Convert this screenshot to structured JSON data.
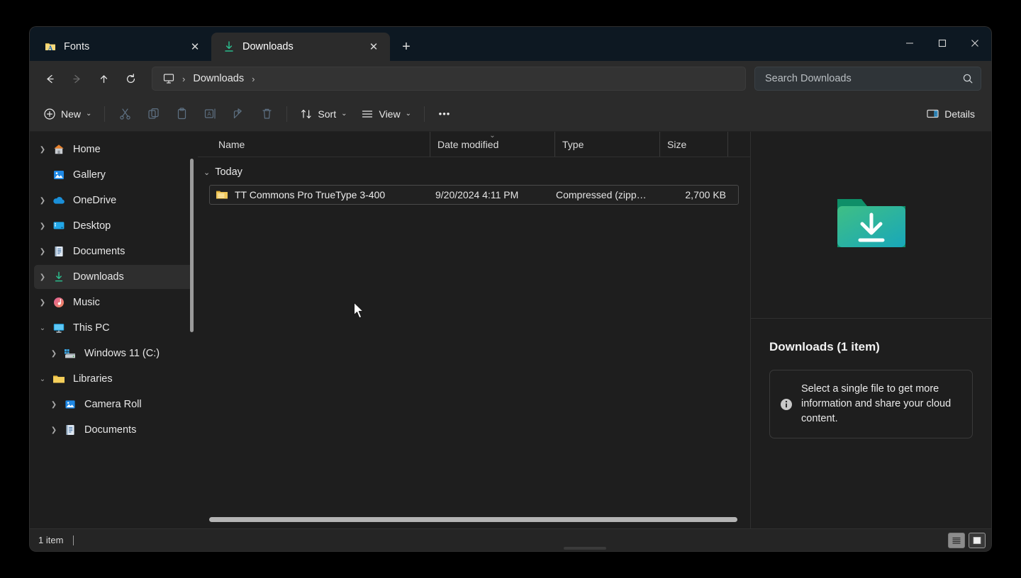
{
  "window": {
    "controls": {
      "minimize": "minimize-button",
      "maximize": "maximize-button",
      "close": "close-button"
    }
  },
  "tabs": [
    {
      "title": "Fonts",
      "icon": "fonts-folder-icon",
      "active": false,
      "close_label": "✕"
    },
    {
      "title": "Downloads",
      "icon": "downloads-arrow-icon",
      "active": true,
      "close_label": "✕"
    }
  ],
  "new_tab_label": "+",
  "navigation": {
    "back": "←",
    "forward": "→",
    "up": "↑",
    "refresh": "↻"
  },
  "breadcrumb": {
    "root_icon": "this-pc-icon",
    "items": [
      "Downloads"
    ],
    "separator": "›"
  },
  "search": {
    "placeholder": "Search Downloads",
    "icon": "search-icon"
  },
  "toolbar": {
    "new_label": "New",
    "new_icon": "plus-circle-icon",
    "cut_icon": "scissors-icon",
    "copy_icon": "copy-icon",
    "paste_icon": "paste-icon",
    "rename_icon": "rename-icon",
    "share_icon": "share-icon",
    "delete_icon": "trash-icon",
    "sort_label": "Sort",
    "sort_icon": "sort-arrows-icon",
    "view_label": "View",
    "view_icon": "view-lines-icon",
    "more_label": "•••",
    "details_label": "Details",
    "details_icon": "details-pane-icon",
    "chevron": "⌄"
  },
  "sidebar": {
    "items": [
      {
        "label": "Home",
        "icon": "home-icon",
        "expandable": true,
        "expanded": false,
        "indent": 0,
        "selected": false
      },
      {
        "label": "Gallery",
        "icon": "gallery-icon",
        "expandable": false,
        "expanded": false,
        "indent": 0,
        "selected": false
      },
      {
        "label": "OneDrive",
        "icon": "onedrive-icon",
        "expandable": true,
        "expanded": false,
        "indent": 0,
        "selected": false
      },
      {
        "label": "Desktop",
        "icon": "desktop-icon",
        "expandable": true,
        "expanded": false,
        "indent": 0,
        "selected": false
      },
      {
        "label": "Documents",
        "icon": "documents-icon",
        "expandable": true,
        "expanded": false,
        "indent": 0,
        "selected": false
      },
      {
        "label": "Downloads",
        "icon": "downloads-arrow-icon",
        "expandable": true,
        "expanded": false,
        "indent": 0,
        "selected": true
      },
      {
        "label": "Music",
        "icon": "music-icon",
        "expandable": true,
        "expanded": false,
        "indent": 0,
        "selected": false
      },
      {
        "label": "This PC",
        "icon": "this-pc-icon",
        "expandable": true,
        "expanded": true,
        "indent": 0,
        "selected": false
      },
      {
        "label": "Windows 11 (C:)",
        "icon": "drive-icon",
        "expandable": true,
        "expanded": false,
        "indent": 1,
        "selected": false
      },
      {
        "label": "Libraries",
        "icon": "folder-icon",
        "expandable": true,
        "expanded": true,
        "indent": 0,
        "selected": false
      },
      {
        "label": "Camera Roll",
        "icon": "gallery-icon",
        "expandable": true,
        "expanded": false,
        "indent": 1,
        "selected": false
      },
      {
        "label": "Documents",
        "icon": "documents-icon",
        "expandable": true,
        "expanded": false,
        "indent": 1,
        "selected": false
      }
    ]
  },
  "filelist": {
    "columns": [
      {
        "key": "name",
        "label": "Name",
        "sorted": false
      },
      {
        "key": "date",
        "label": "Date modified",
        "sorted": true,
        "sort_indicator": "⌄"
      },
      {
        "key": "type",
        "label": "Type",
        "sorted": false
      },
      {
        "key": "size",
        "label": "Size",
        "sorted": false
      }
    ],
    "groups": [
      {
        "label": "Today",
        "chevron": "⌄",
        "rows": [
          {
            "name": "TT Commons Pro TrueType 3-400",
            "date": "9/20/2024 4:11 PM",
            "type": "Compressed (zipp…",
            "size": "2,700 KB",
            "icon": "zip-folder-icon",
            "focused": true
          }
        ]
      }
    ]
  },
  "details_pane": {
    "preview_icon": "downloads-folder-large-icon",
    "title": "Downloads (1 item)",
    "info_icon": "info-icon",
    "info_text": "Select a single file to get more information and share your cloud content."
  },
  "statusbar": {
    "item_count": "1 item",
    "view_details_icon": "details-view-icon",
    "view_large_icons_icon": "large-icons-view-icon"
  },
  "colors": {
    "titlebar": "#0d1822",
    "toolbar": "#2b2b2b",
    "content": "#1e1e1e",
    "accent_green": "#2bbb8c",
    "accent_blue": "#2d9cdb",
    "selected_row": "#2e2e2e"
  }
}
